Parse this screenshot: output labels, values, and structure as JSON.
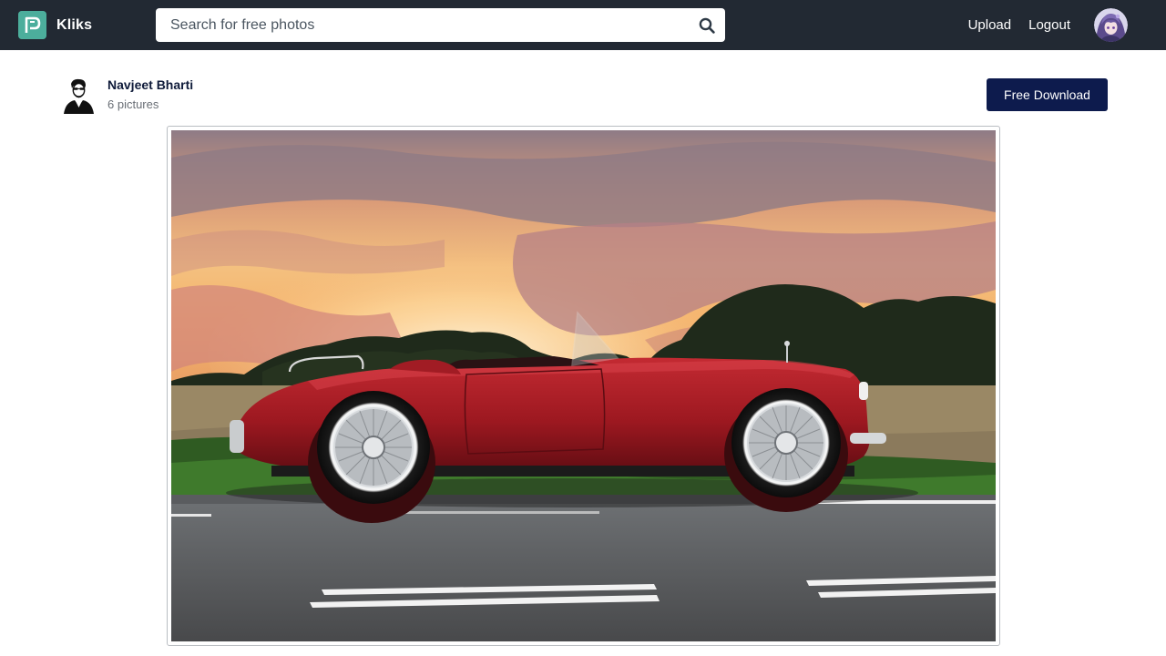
{
  "header": {
    "brand_name": "Kliks",
    "logo_icon": "kliks-logo-icon",
    "search": {
      "placeholder": "Search for free photos",
      "value": "",
      "icon": "search-icon"
    },
    "nav": {
      "upload_label": "Upload",
      "logout_label": "Logout"
    },
    "colors": {
      "bar": "#222933",
      "logo": "#4cae9c"
    }
  },
  "author": {
    "name": "Navjeet Bharti",
    "picture_count": "6 pictures"
  },
  "actions": {
    "download_label": "Free Download",
    "download_color": "#0d1b4d"
  },
  "photo": {
    "subject": "red-convertible-car-at-sunset"
  }
}
